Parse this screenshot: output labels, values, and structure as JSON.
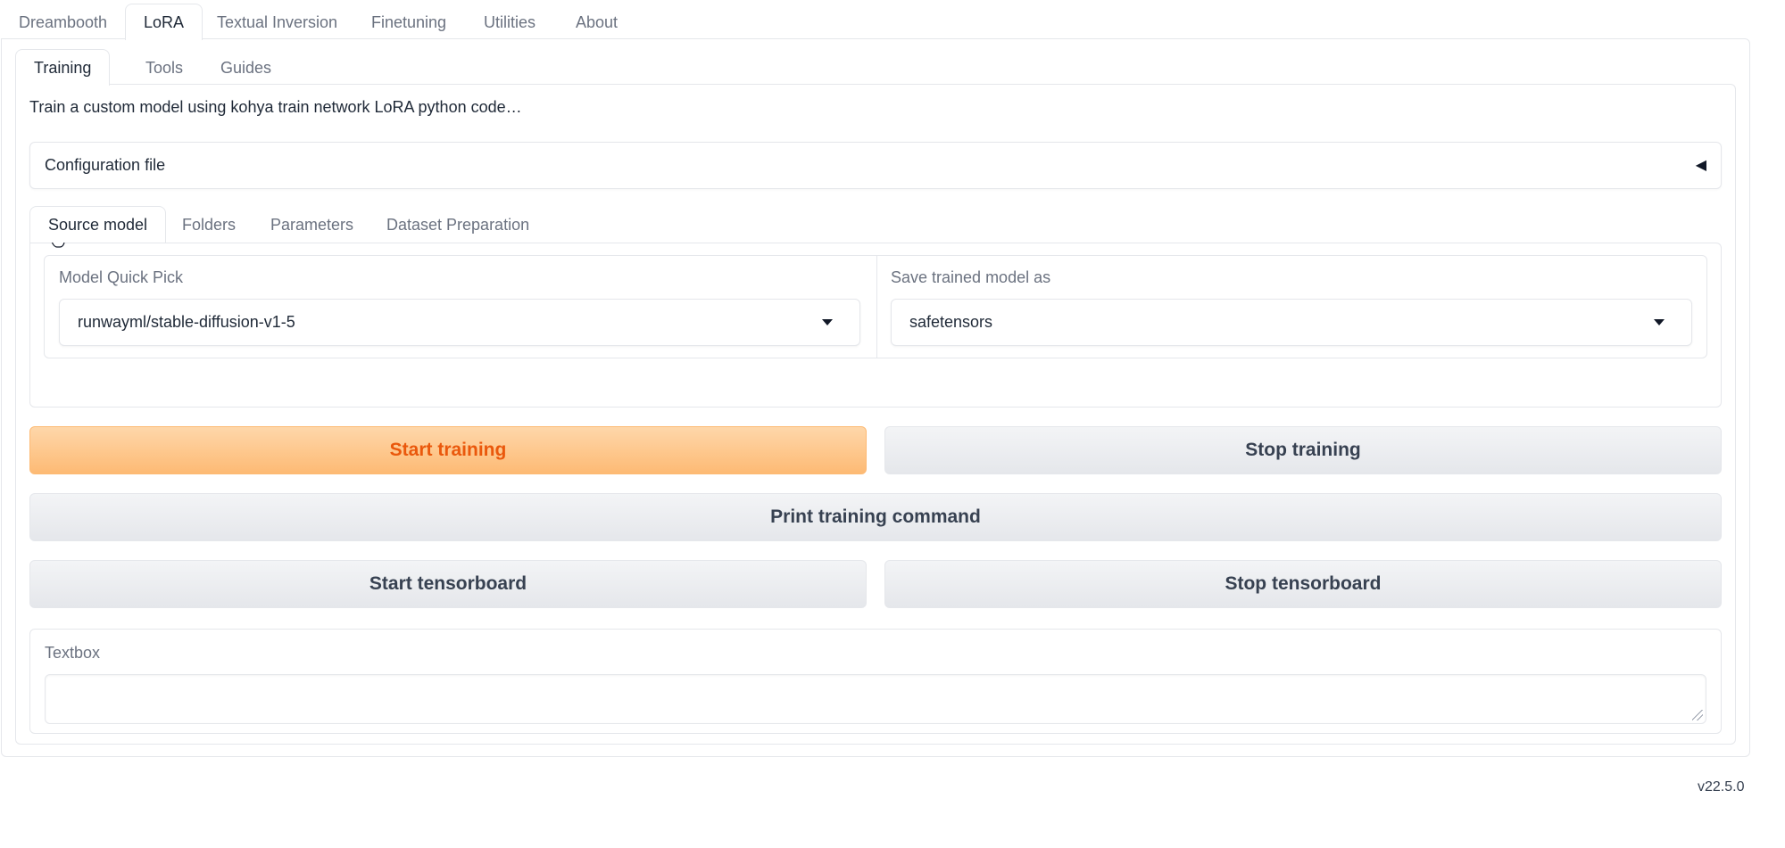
{
  "top_tabs": [
    "Dreambooth",
    "LoRA",
    "Textual Inversion",
    "Finetuning",
    "Utilities",
    "About"
  ],
  "active_top_tab": "LoRA",
  "sub_tabs": [
    "Training",
    "Tools",
    "Guides"
  ],
  "active_sub_tab": "Training",
  "description": "Train a custom model using kohya train network LoRA python code…",
  "config_file": {
    "label": "Configuration file",
    "toggle": "◀"
  },
  "model_tabs": [
    "Source model",
    "Folders",
    "Parameters",
    "Dataset Preparation"
  ],
  "active_model_tab": "Source model",
  "model_quick_pick": {
    "label": "Model Quick Pick",
    "value": "runwayml/stable-diffusion-v1-5"
  },
  "save_model_as": {
    "label": "Save trained model as",
    "value": "safetensors"
  },
  "buttons": {
    "start_training": "Start training",
    "stop_training": "Stop training",
    "print_command": "Print training command",
    "start_tensorboard": "Start tensorboard",
    "stop_tensorboard": "Stop tensorboard"
  },
  "textbox": {
    "label": "Textbox",
    "value": ""
  },
  "version": "v22.5.0",
  "colors": {
    "accent": "#ea580c",
    "accent_bg": "#fdba74",
    "border": "#e5e7eb"
  }
}
